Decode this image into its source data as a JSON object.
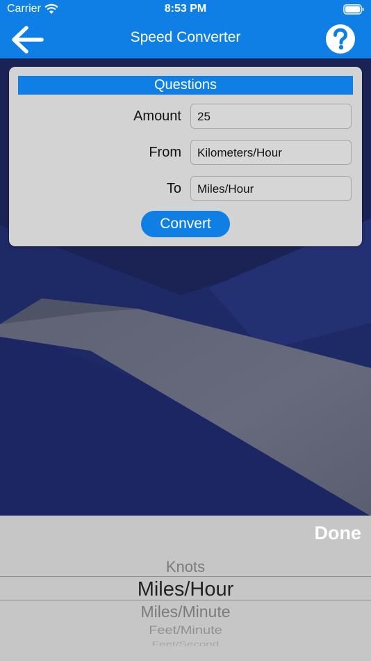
{
  "status_bar": {
    "carrier": "Carrier",
    "time": "8:53 PM"
  },
  "nav": {
    "title": "Speed Converter",
    "back_icon": "arrow-left-icon",
    "help_icon": "question-circle-icon"
  },
  "colors": {
    "accent": "#0f7fe6",
    "card": "#d3d3d3",
    "backdrop": "#1c2553",
    "picker": "#c6c6c6"
  },
  "questions": {
    "header": "Questions",
    "amount_label": "Amount",
    "amount_value": "25",
    "from_label": "From",
    "from_value": "Kilometers/Hour",
    "to_label": "To",
    "to_value": "Miles/Hour",
    "convert_label": "Convert"
  },
  "picker": {
    "done_label": "Done",
    "items": [
      "Knots",
      "Miles/Hour",
      "Miles/Minute",
      "Feet/Minute",
      "Feet/Second"
    ],
    "selected": "Miles/Hour"
  }
}
